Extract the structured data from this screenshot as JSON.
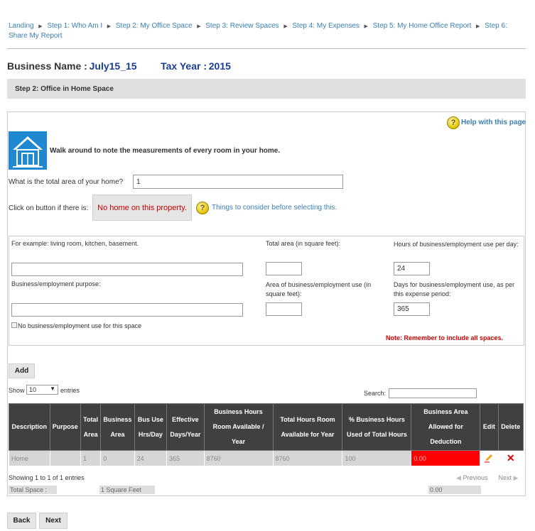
{
  "breadcrumb": [
    {
      "label": "Landing"
    },
    {
      "label": "Step 1: Who Am I"
    },
    {
      "label": "Step 2: My Office Space"
    },
    {
      "label": "Step 3: Review Spaces"
    },
    {
      "label": "Step 4: My Expenses"
    },
    {
      "label": "Step 5: My Home Office Report"
    },
    {
      "label": "Step 6:"
    },
    {
      "label": "Share My Report"
    }
  ],
  "header": {
    "business_label": "Business Name :",
    "business_name": "July15_15",
    "tax_year_label": "Tax Year :",
    "tax_year": "2015"
  },
  "step_title": "Step 2: Office in Home Space",
  "help_link": "Help with this page",
  "intro_text": "Walk around to note the measurements of every room in your home.",
  "total_area": {
    "label": "What is the total area of your home?",
    "value": "1"
  },
  "no_home": {
    "label": "Click on button if there is:",
    "button": "No home on this property.",
    "consider_link": "Things to consider before selecting this."
  },
  "space_form": {
    "example_label": "For example: living room, kitchen, basement.",
    "total_area_label": "Total area (in square feet):",
    "hours_label": "Hours of business/employment use per day:",
    "hours_value": "24",
    "purpose_label": "Business/employment purpose:",
    "business_area_label": "Area of business/employment use (in square feet):",
    "days_label": "Days for business/employment use, as per this expense period:",
    "days_value": "365",
    "no_use_label": "No business/employment use for this space",
    "note_prefix": "Note:",
    "note_text": " Remember to include all spaces."
  },
  "add_button": "Add",
  "table_controls": {
    "show_label": "Show",
    "page_size": "10",
    "entries_label": "entries",
    "search_label": "Search:"
  },
  "table": {
    "headers": [
      "Description",
      "Purpose",
      "Total Area",
      "Business Area",
      "Bus Use Hrs/Day",
      "Effective Days/Year",
      "Business Hours Room Available / Year",
      "Total Hours Room Available for Year",
      "% Business Hours Used of Total Hours",
      "Business Area Allowed for Deduction",
      "Edit",
      "Delete"
    ],
    "rows": [
      [
        "Home",
        "",
        "1",
        "0",
        "24",
        "365",
        "8760",
        "8760",
        "100",
        "0.00"
      ]
    ]
  },
  "table_footer": {
    "showing": "Showing 1 to 1 of 1 entries",
    "previous": "Previous",
    "next": "Next",
    "total_space_label": "Total Space :",
    "total_space_value": "1 Square Feet",
    "total_deduction": "0.00"
  },
  "nav": {
    "back": "Back",
    "next": "Next"
  },
  "colors": {
    "link": "#3a7fb3",
    "accent_blue": "#1a3d8f",
    "header_dark": "#404040",
    "alert_red": "#ff0000",
    "note_red": "#cc0000"
  }
}
